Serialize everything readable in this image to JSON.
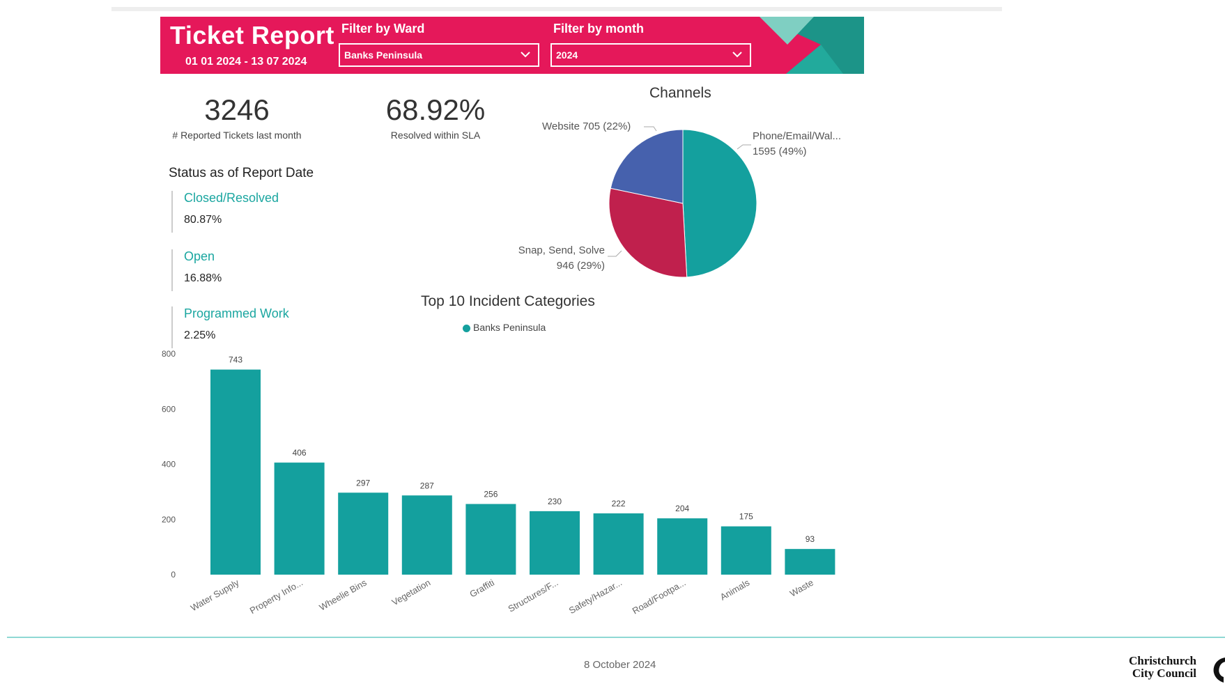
{
  "header": {
    "title": "Ticket Report",
    "date_range": "01 01 2024 - 13 07 2024",
    "ward_filter_label": "Filter by Ward",
    "ward_filter_value": "Banks Peninsula",
    "month_filter_label": "Filter by month",
    "month_filter_value": "2024"
  },
  "kpis": {
    "reported_value": "3246",
    "reported_label": "# Reported Tickets last month",
    "sla_value": "68.92%",
    "sla_label": "Resolved within SLA"
  },
  "status": {
    "title": "Status as of Report Date",
    "items": [
      {
        "name": "Closed/Resolved",
        "pct": "80.87%"
      },
      {
        "name": "Open",
        "pct": "16.88%"
      },
      {
        "name": "Programmed Work",
        "pct": "2.25%"
      }
    ]
  },
  "channels_title": "Channels",
  "channels_labels": {
    "phone_line1": "Phone/Email/Wal...",
    "phone_line2": "1595 (49%)",
    "website": "Website 705 (22%)",
    "snap_line1": "Snap, Send, Solve",
    "snap_line2": "946 (29%)"
  },
  "colors": {
    "banner": "#e5185a",
    "teal": "#14a09e",
    "blue": "#4661ad",
    "crimson": "#c0204d"
  },
  "incident_title": "Top 10 Incident Categories",
  "legend_label": "Banks Peninsula",
  "chart_data": [
    {
      "type": "pie",
      "title": "Channels",
      "slices": [
        {
          "label": "Phone/Email/Wal...",
          "value": 1595,
          "percent": 49,
          "color": "#14a09e"
        },
        {
          "label": "Snap, Send, Solve",
          "value": 946,
          "percent": 29,
          "color": "#c0204d"
        },
        {
          "label": "Website",
          "value": 705,
          "percent": 22,
          "color": "#4661ad"
        }
      ]
    },
    {
      "type": "bar",
      "title": "Top 10 Incident Categories",
      "categories": [
        "Water Supply",
        "Property Info...",
        "Wheelie Bins",
        "Vegetation",
        "Graffiti",
        "Structures/F...",
        "Safety/Hazar...",
        "Road/Footpa...",
        "Animals",
        "Waste"
      ],
      "series": [
        {
          "name": "Banks Peninsula",
          "values": [
            743,
            406,
            297,
            287,
            256,
            230,
            222,
            204,
            175,
            93
          ]
        }
      ],
      "ylim": [
        0,
        800
      ],
      "yticks": [
        0,
        200,
        400,
        600,
        800
      ]
    }
  ],
  "footer": {
    "date": "8 October 2024",
    "logo_line1": "Christchurch",
    "logo_line2": "City Council"
  }
}
